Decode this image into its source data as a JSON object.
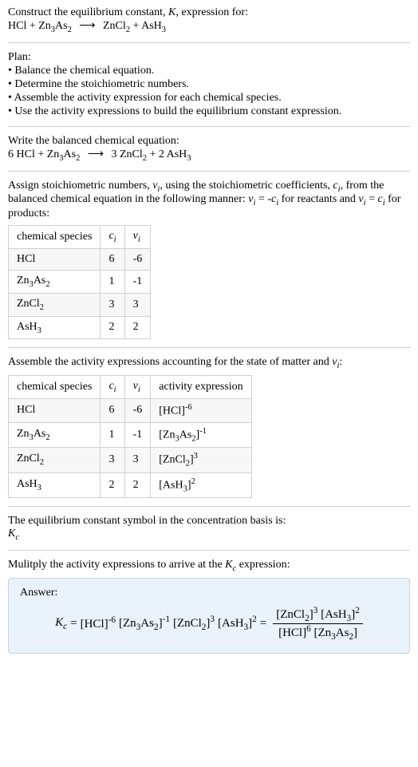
{
  "header": {
    "construct_line": "Construct the equilibrium constant, K, expression for:"
  },
  "plan": {
    "title": "Plan:",
    "b1": "• Balance the chemical equation.",
    "b2": "• Determine the stoichiometric numbers.",
    "b3": "• Assemble the activity expression for each chemical species.",
    "b4": "• Use the activity expressions to build the equilibrium constant expression."
  },
  "balanced": {
    "title": "Write the balanced chemical equation:"
  },
  "assign": {
    "line1a": "Assign stoichiometric numbers, ",
    "line1b": ", using the stoichiometric coefficients, ",
    "line1c": ", from",
    "line2a": "the balanced chemical equation in the following manner: ",
    "line2b": " for reactants",
    "line3a": "and ",
    "line3b": " for products:"
  },
  "table1": {
    "h1": "chemical species",
    "h2_ci": "c",
    "h3_vi": "ν",
    "r1c1": "HCl",
    "r1c2": "6",
    "r1c3": "-6",
    "r2c1": "Zn₃As₂",
    "r2c2": "1",
    "r2c3": "-1",
    "r3c1": "ZnCl₂",
    "r3c2": "3",
    "r3c3": "3",
    "r4c1": "AsH₃",
    "r4c2": "2",
    "r4c3": "2"
  },
  "assemble": {
    "line": "Assemble the activity expressions accounting for the state of matter and "
  },
  "table2": {
    "h1": "chemical species",
    "h4": "activity expression",
    "r1c2": "6",
    "r1c3": "-6",
    "r2c2": "1",
    "r2c3": "-1",
    "r3c2": "3",
    "r3c3": "3",
    "r4c2": "2",
    "r4c3": "2"
  },
  "eqsym": {
    "line": "The equilibrium constant symbol in the concentration basis is:"
  },
  "multiply": {
    "line": "Mulitply the activity expressions to arrive at the "
  },
  "answer": {
    "title": "Answer:"
  },
  "chart_data": {
    "type": "table",
    "tables": [
      {
        "title": "Stoichiometric numbers",
        "columns": [
          "chemical species",
          "c_i",
          "ν_i"
        ],
        "rows": [
          [
            "HCl",
            6,
            -6
          ],
          [
            "Zn3As2",
            1,
            -1
          ],
          [
            "ZnCl2",
            3,
            3
          ],
          [
            "AsH3",
            2,
            2
          ]
        ]
      },
      {
        "title": "Activity expressions",
        "columns": [
          "chemical species",
          "c_i",
          "ν_i",
          "activity expression"
        ],
        "rows": [
          [
            "HCl",
            6,
            -6,
            "[HCl]^-6"
          ],
          [
            "Zn3As2",
            1,
            -1,
            "[Zn3As2]^-1"
          ],
          [
            "ZnCl2",
            3,
            3,
            "[ZnCl2]^3"
          ],
          [
            "AsH3",
            2,
            2,
            "[AsH3]^2"
          ]
        ]
      }
    ],
    "unbalanced_equation": "HCl + Zn3As2 -> ZnCl2 + AsH3",
    "balanced_equation": "6 HCl + Zn3As2 -> 3 ZnCl2 + 2 AsH3",
    "Kc_expression": "Kc = [HCl]^-6 [Zn3As2]^-1 [ZnCl2]^3 [AsH3]^2 = ([ZnCl2]^3 [AsH3]^2) / ([HCl]^6 [Zn3As2])"
  }
}
